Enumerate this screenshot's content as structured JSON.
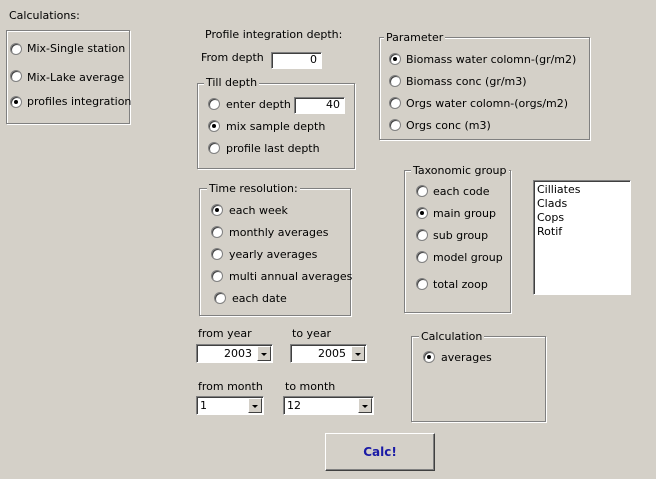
{
  "calculations": {
    "title": "Calculations:",
    "options": [
      {
        "label": "Mix-Single station",
        "selected": false
      },
      {
        "label": "Mix-Lake average",
        "selected": false
      },
      {
        "label": "profiles integration",
        "selected": true
      }
    ]
  },
  "profile": {
    "title": "Profile integration depth:",
    "from_depth_label": "From depth",
    "from_depth_value": "0"
  },
  "till_depth": {
    "title": "Till depth",
    "options": [
      {
        "label": "enter depth",
        "selected": false
      },
      {
        "label": "mix sample depth",
        "selected": true
      },
      {
        "label": "profile last depth",
        "selected": false
      }
    ],
    "enter_depth_value": "40"
  },
  "time_resolution": {
    "title": "Time resolution:",
    "options": [
      {
        "label": "each week",
        "selected": true
      },
      {
        "label": "monthly averages",
        "selected": false
      },
      {
        "label": "yearly averages",
        "selected": false
      },
      {
        "label": "multi annual averages",
        "selected": false
      },
      {
        "label": "each date",
        "selected": false
      }
    ]
  },
  "period": {
    "from_year_label": "from year",
    "from_year_value": "2003",
    "to_year_label": "to year",
    "to_year_value": "2005",
    "from_month_label": "from month",
    "from_month_value": "1",
    "to_month_label": "to month",
    "to_month_value": "12"
  },
  "parameter": {
    "title": "Parameter",
    "options": [
      {
        "label": "Biomass water colomn-(gr/m2)",
        "selected": true
      },
      {
        "label": "Biomass conc  (gr/m3)",
        "selected": false
      },
      {
        "label": "Orgs water colomn-(orgs/m2)",
        "selected": false
      },
      {
        "label": "Orgs conc (m3)",
        "selected": false
      }
    ]
  },
  "taxonomic": {
    "title": "Taxonomic group",
    "options": [
      {
        "label": "each code",
        "selected": false
      },
      {
        "label": "main group",
        "selected": true
      },
      {
        "label": "sub group",
        "selected": false
      },
      {
        "label": "model group",
        "selected": false
      },
      {
        "label": "total zoop",
        "selected": false
      }
    ]
  },
  "groups_list": [
    "Cilliates",
    "Clads",
    "Cops",
    "Rotif"
  ],
  "calculation": {
    "title": "Calculation",
    "options": [
      {
        "label": "averages",
        "selected": true
      }
    ]
  },
  "calc_button": "Calc!"
}
